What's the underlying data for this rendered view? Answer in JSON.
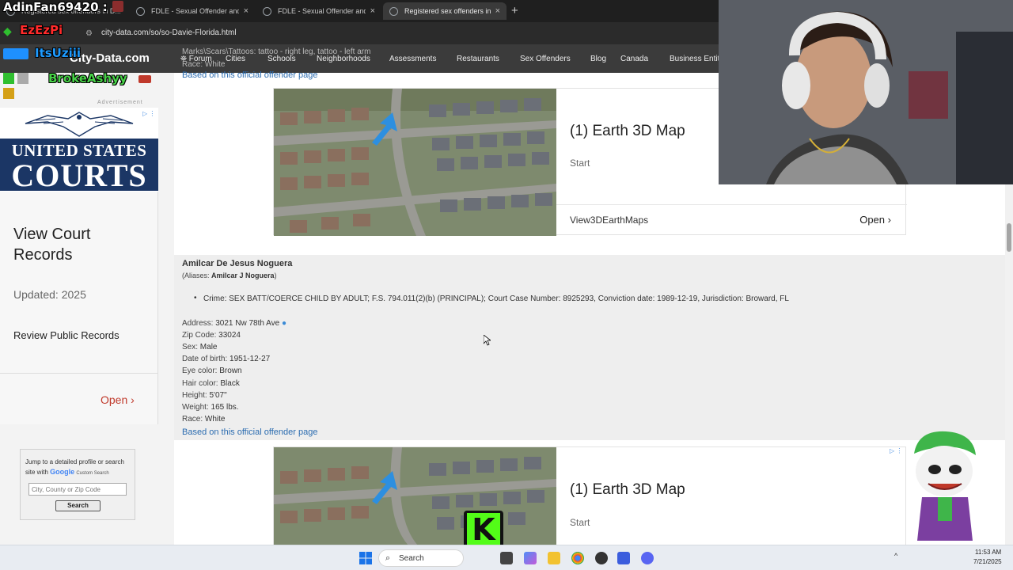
{
  "browser": {
    "tabs": [
      {
        "title": "Registered sex offenders in D...",
        "active": false
      },
      {
        "title": "FDLE - Sexual Offender and Pre",
        "active": false
      },
      {
        "title": "FDLE - Sexual Offender and Pre",
        "active": false
      },
      {
        "title": "Registered sex offenders in Da",
        "active": true
      }
    ],
    "new_tab": "+",
    "close": "×",
    "url": "city-data.com/so/so-Davie-Florida.html"
  },
  "site": {
    "logo": "City-Data.com",
    "nav": [
      "Forum",
      "Cities",
      "Schools",
      "Neighborhoods",
      "Assessments",
      "Restaurants",
      "Sex Offenders",
      "Blog",
      "Canada",
      "Business Entiti"
    ]
  },
  "overlay_users": [
    "AdinFan69420 :",
    "EzEzPi",
    "ItsUziii",
    "BrokeAshyy"
  ],
  "left_ad": {
    "label": "Advertisement",
    "logo_line1": "UNITED STATES",
    "logo_line2": "COURTS",
    "title": "View Court Records",
    "updated": "Updated: 2025",
    "review": "Review Public Records",
    "open": "Open"
  },
  "search_box": {
    "text": "Jump to a detailed profile or search site with",
    "google": "Google",
    "custom": "Custom Search",
    "placeholder": "City, County or Zip Code",
    "button": "Search"
  },
  "prev_record": {
    "marks": "Marks\\Scars\\Tattoos: tattoo - right leg, tattoo - left arm",
    "race_partial": "Race: White",
    "link": "Based on this official offender page"
  },
  "ad_cards": [
    {
      "headline": "(1) Earth 3D Map",
      "start": "Start",
      "footer_left": "View3DEarthMaps",
      "footer_right": "Open"
    },
    {
      "headline": "(1) Earth 3D Map",
      "start": "Start"
    }
  ],
  "record": {
    "name": "Amilcar De Jesus Noguera",
    "aliases_label": "Aliases:",
    "aliases": "Amilcar J Noguera",
    "crime_label": "Crime:",
    "crime": "SEX BATT/COERCE CHILD BY ADULT; F.S. 794.011(2)(b) (PRINCIPAL); Court Case Number: 8925293, Conviction date: 1989-12-19, Jurisdiction: Broward, FL",
    "fields": [
      {
        "label": "Address:",
        "value": "3021 Nw 78th Ave"
      },
      {
        "label": "Zip Code:",
        "value": "33024"
      },
      {
        "label": "Sex:",
        "value": "Male"
      },
      {
        "label": "Date of birth:",
        "value": "1951-12-27"
      },
      {
        "label": "Eye color:",
        "value": "Brown"
      },
      {
        "label": "Hair color:",
        "value": "Black"
      },
      {
        "label": "Height:",
        "value": "5'07\""
      },
      {
        "label": "Weight:",
        "value": "165 lbs."
      },
      {
        "label": "Race:",
        "value": "White"
      }
    ],
    "link": "Based on this official offender page"
  },
  "taskbar": {
    "search": "Search",
    "time": "11:53 AM",
    "date": "7/21/2025"
  },
  "kick_letter": "K",
  "colors": {
    "nav_bg": "#3b3b3b",
    "link": "#2b6cb0",
    "ad_open": "#c0392b",
    "courts_blue": "#1b3665",
    "kick_green": "#53fc18"
  }
}
